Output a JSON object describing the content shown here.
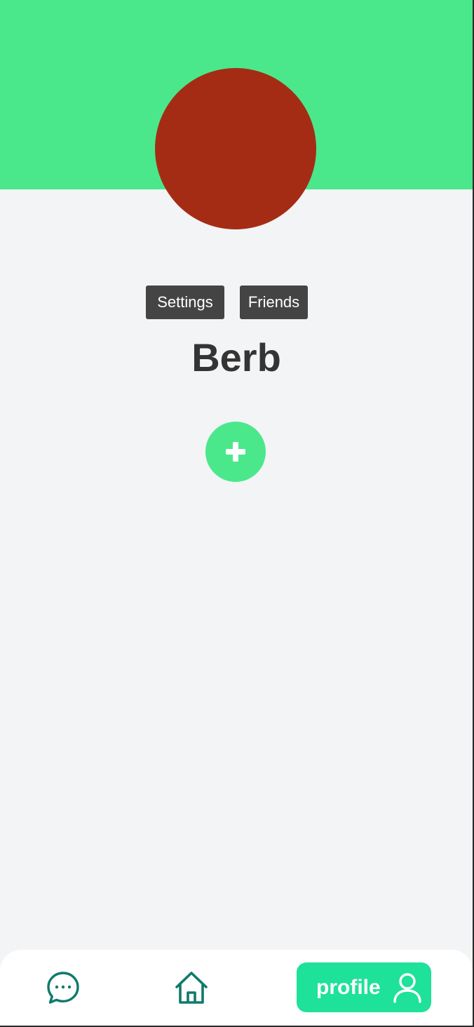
{
  "colors": {
    "header_green": "#4ae88b",
    "avatar_red": "#a52c14",
    "button_dark": "#444444",
    "add_green": "#4ae88b",
    "nav_teal": "#0f7a6b",
    "profile_tab_bg": "#1ee19a"
  },
  "profile": {
    "username": "Berb",
    "avatar_icon": "avatar-circle"
  },
  "actions": {
    "settings_label": "Settings",
    "friends_label": "Friends"
  },
  "add_button": {
    "icon": "plus-icon"
  },
  "bottom_nav": {
    "chat_icon": "chat-bubble-icon",
    "home_icon": "home-icon",
    "profile_label": "profile",
    "profile_icon": "user-icon",
    "active_tab": "profile"
  }
}
